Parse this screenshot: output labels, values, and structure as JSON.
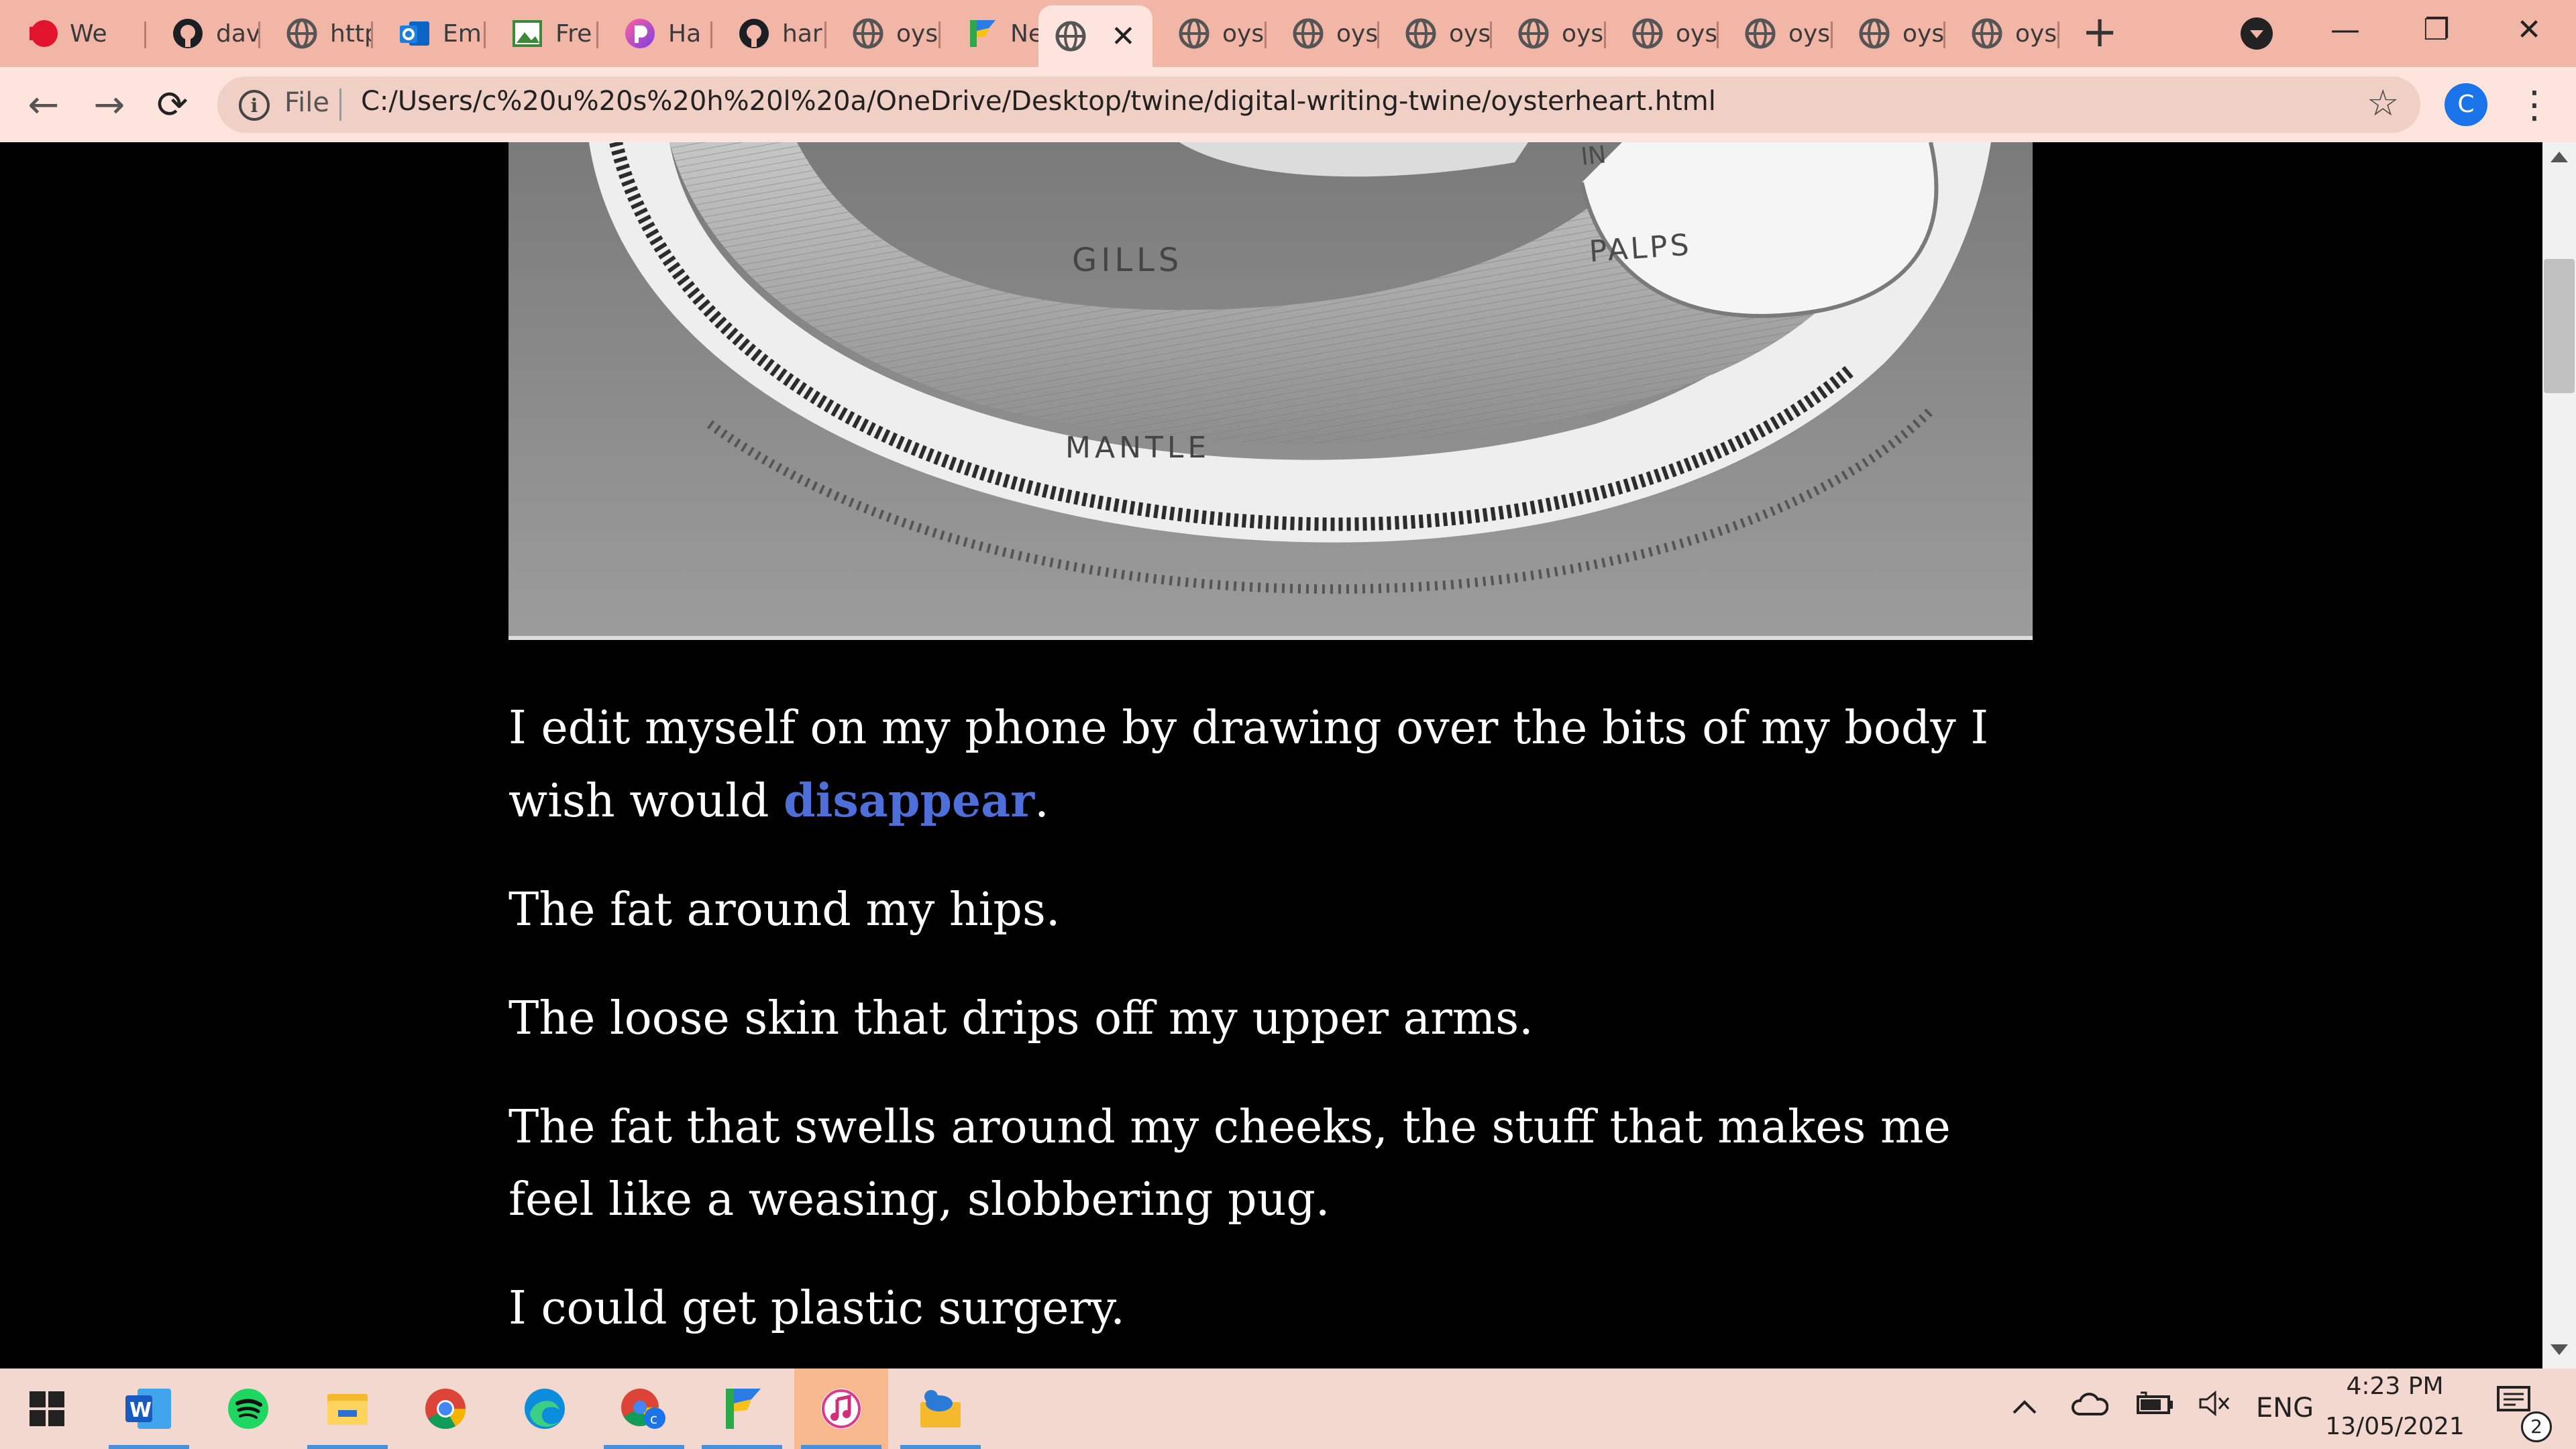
{
  "tabs": [
    {
      "label": "We",
      "icon": "red-favicon-icon"
    },
    {
      "label": "dav",
      "icon": "github-icon"
    },
    {
      "label": "http",
      "icon": "globe-icon"
    },
    {
      "label": "Em",
      "icon": "outlook-icon"
    },
    {
      "label": "Fre",
      "icon": "image-icon"
    },
    {
      "label": "Ha",
      "icon": "harmony-icon"
    },
    {
      "label": "har",
      "icon": "github-icon"
    },
    {
      "label": "oys",
      "icon": "globe-icon"
    },
    {
      "label": "Ne",
      "icon": "flag-icon"
    },
    {
      "label": "",
      "icon": "globe-icon",
      "active": true,
      "close": "✕"
    },
    {
      "label": "oys",
      "icon": "globe-icon"
    },
    {
      "label": "oys",
      "icon": "globe-icon"
    },
    {
      "label": "oys",
      "icon": "globe-icon"
    },
    {
      "label": "oys",
      "icon": "globe-icon"
    },
    {
      "label": "oys",
      "icon": "globe-icon"
    },
    {
      "label": "oys",
      "icon": "globe-icon"
    },
    {
      "label": "oys",
      "icon": "globe-icon"
    },
    {
      "label": "oys",
      "icon": "globe-icon"
    }
  ],
  "tabstrip": {
    "new_tab": "+",
    "minimize": "—",
    "restore": "❐",
    "close": "✕"
  },
  "toolbar": {
    "back": "←",
    "forward": "→",
    "reload": "⟳",
    "info": "i",
    "scheme": "File",
    "url": "C:/Users/c%20u%20s%20h%20l%20a/OneDrive/Desktop/twine/digital-writing-twine/oysterheart.html",
    "star": "☆",
    "profile_initial": "C",
    "menu": "⋮"
  },
  "illustration": {
    "labels": {
      "palps": "PALPS",
      "gills": "GILLS",
      "mantle": "MANTLE",
      "partial": "IN"
    },
    "colors": {
      "background": "#8c8c8c",
      "shell": "#ececec",
      "gills": "#a9a9a9"
    }
  },
  "passage": {
    "p1_before": "I edit myself on my phone by drawing over the bits of my body I wish would ",
    "p1_link": "disappear",
    "p1_after": ".",
    "p2": "The fat around my hips.",
    "p3": "The loose skin that drips off my upper arms.",
    "p4": "The fat that swells around my cheeks, the stuff that makes me feel like a weasing, slobbering pug.",
    "p5": "I could get plastic surgery."
  },
  "colors": {
    "link": "#4e6fd9",
    "page_bg": "#000000",
    "text": "#ffffff",
    "tabstrip": "#f2b6a6",
    "toolbar": "#fde5dd"
  },
  "taskbar": {
    "apps": [
      {
        "name": "start-icon"
      },
      {
        "name": "word-icon",
        "running": true
      },
      {
        "name": "spotify-icon"
      },
      {
        "name": "file-explorer-icon",
        "running": true
      },
      {
        "name": "chrome-icon"
      },
      {
        "name": "edge-icon"
      },
      {
        "name": "chrome-profile-icon",
        "running": true
      },
      {
        "name": "flag-app-icon",
        "running": true
      },
      {
        "name": "itunes-icon",
        "running": true,
        "highlight": true
      },
      {
        "name": "cloud-folder-icon",
        "running": true
      }
    ],
    "tray": {
      "chevron": "^",
      "language": "ENG",
      "volume": "🔇"
    },
    "time": "4:23 PM",
    "date": "13/05/2021",
    "notifications": "2"
  }
}
